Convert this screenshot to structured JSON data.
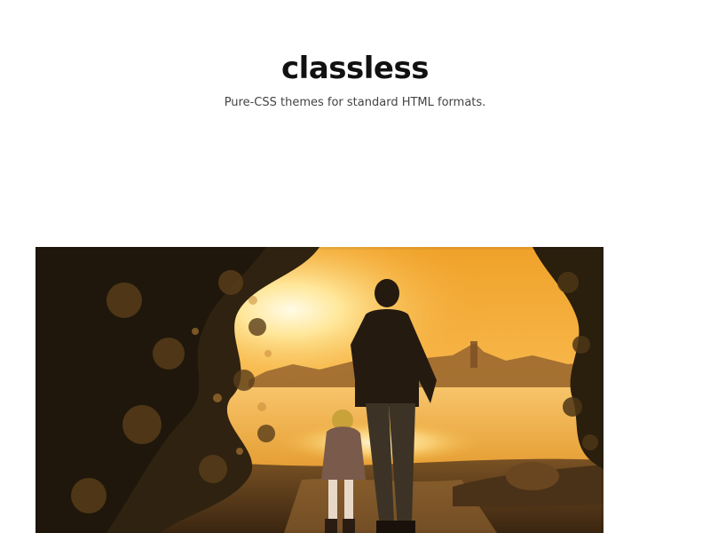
{
  "header": {
    "title": "classless",
    "tagline": "Pure-CSS themes for standard HTML formats."
  },
  "hero_image": {
    "description_icon": "sunset-photo-father-child",
    "colors": {
      "sky_top": "#f6a620",
      "sky_glow": "#ffe9a8",
      "water": "#f2b640",
      "foliage": "#3b2a12",
      "ground": "#5a3d1a"
    }
  }
}
